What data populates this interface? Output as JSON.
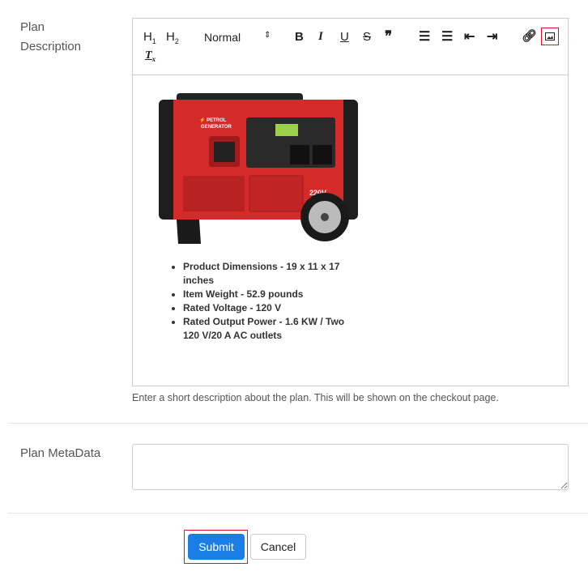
{
  "plan_description": {
    "label_line1": "Plan",
    "label_line2": "Description",
    "toolbar": {
      "h1": "H1",
      "h2": "H2",
      "format": "Normal",
      "bold": "B",
      "italic": "I",
      "underline": "U",
      "strike": "S",
      "quote": "❞",
      "clear": "Tx"
    },
    "image_text": {
      "brand1": "PETROL",
      "brand2": "GENERATOR",
      "voltage": "220V"
    },
    "specs": [
      "Product Dimensions - 19 x 11 x 17 inches",
      "Item Weight - 52.9 pounds",
      "Rated Voltage - 120 V",
      "Rated Output Power - 1.6 KW / Two 120 V/20 A AC outlets"
    ],
    "hint": "Enter a short description about the plan. This will be shown on the checkout page."
  },
  "plan_metadata": {
    "label": "Plan MetaData",
    "value": ""
  },
  "actions": {
    "submit": "Submit",
    "cancel": "Cancel"
  },
  "colors": {
    "primary": "#1a7ee6",
    "highlight": "#e0141e",
    "generator_red": "#d42a2a"
  }
}
